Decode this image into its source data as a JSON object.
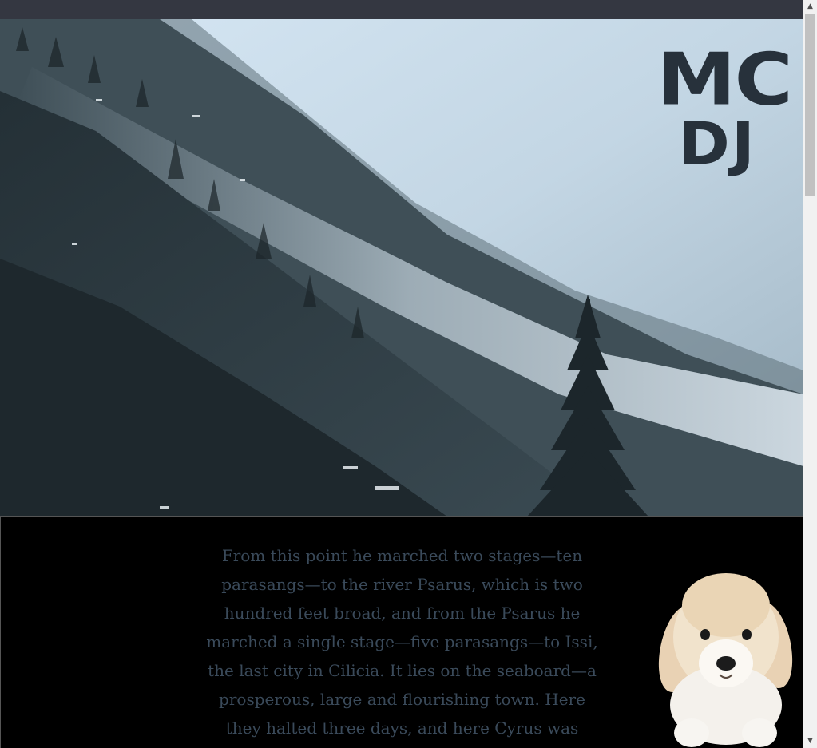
{
  "logo": {
    "line1": "MC",
    "line2": "DJ"
  },
  "hero": {
    "image": "misty-forest-mountain"
  },
  "story": {
    "text": "From this point he marched two stages—ten parasangs—to the river Psarus, which is two hundred feet broad, and from the Psarus he marched a single stage—five parasangs—to Issi, the last city in Cilicia. It lies on the seaboard—a prosperous, large and flourishing town. Here they halted three days, and here Cyrus was joined by his"
  },
  "puppy": {
    "image": "puppy-icon"
  },
  "scrollbar": {
    "up_arrow": "▲",
    "down_arrow": "▼"
  },
  "colors": {
    "topbar": "#343741",
    "logo": "#27313b",
    "story_text": "#3a4a5a",
    "content_bg": "#000000"
  }
}
